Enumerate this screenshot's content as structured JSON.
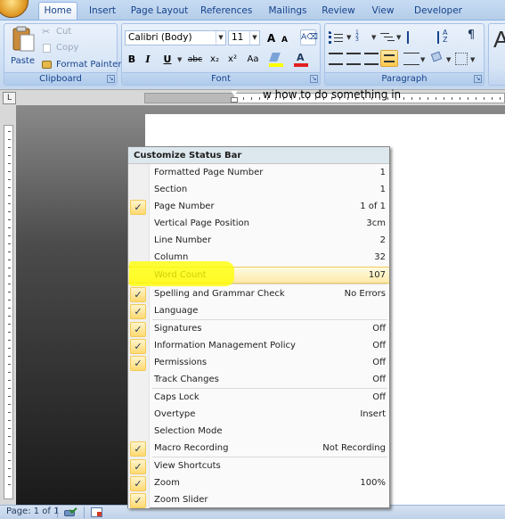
{
  "ribbon": {
    "tabs": [
      "Home",
      "Insert",
      "Page Layout",
      "References",
      "Mailings",
      "Review",
      "View",
      "Developer"
    ],
    "clipboard": {
      "paste_label": "Paste",
      "cut_label": "Cut",
      "copy_label": "Copy",
      "format_painter_label": "Format Painter",
      "group_label": "Clipboard"
    },
    "font": {
      "font_name": "Calibri (Body)",
      "font_size": "11",
      "bold": "B",
      "italic": "I",
      "underline": "U",
      "strikethrough": "abc",
      "subscript": "x₂",
      "superscript": "x²",
      "change_case": "Aa",
      "grow_font": "A",
      "shrink_font": "A",
      "font_color_glyph": "A",
      "group_label": "Font"
    },
    "paragraph": {
      "group_label": "Paragraph",
      "pilcrow": "¶"
    },
    "styles_glyph": "A"
  },
  "document": {
    "visible_text": "w how to do something in"
  },
  "status_bar": {
    "page": "Page: 1 of 1"
  },
  "menu": {
    "title": "Customize Status Bar",
    "items": [
      {
        "label": "Formatted Page Number",
        "value": "1",
        "checked": false
      },
      {
        "label": "Section",
        "value": "1",
        "checked": false
      },
      {
        "label": "Page Number",
        "value": "1 of 1",
        "checked": true
      },
      {
        "label": "Vertical Page Position",
        "value": "3cm",
        "checked": false
      },
      {
        "label": "Line Number",
        "value": "2",
        "checked": false
      },
      {
        "label": "Column",
        "value": "32",
        "checked": false
      },
      {
        "label": "Word Count",
        "value": "107",
        "checked": false,
        "highlighted": true
      },
      {
        "label": "Spelling and Grammar Check",
        "value": "No Errors",
        "checked": true
      },
      {
        "label": "Language",
        "value": "",
        "checked": true
      },
      {
        "label": "Signatures",
        "value": "Off",
        "checked": true
      },
      {
        "label": "Information Management Policy",
        "value": "Off",
        "checked": true
      },
      {
        "label": "Permissions",
        "value": "Off",
        "checked": true
      },
      {
        "label": "Track Changes",
        "value": "Off",
        "checked": false
      },
      {
        "label": "Caps Lock",
        "value": "Off",
        "checked": false
      },
      {
        "label": "Overtype",
        "value": "Insert",
        "checked": false
      },
      {
        "label": "Selection Mode",
        "value": "",
        "checked": false
      },
      {
        "label": "Macro Recording",
        "value": "Not Recording",
        "checked": true
      },
      {
        "label": "View Shortcuts",
        "value": "",
        "checked": true
      },
      {
        "label": "Zoom",
        "value": "100%",
        "checked": true
      },
      {
        "label": "Zoom Slider",
        "value": "",
        "checked": true
      }
    ],
    "check_glyph": "✓"
  },
  "colors": {
    "ribbon_blue": "#15428b",
    "menu_highlight": "#fde9a8",
    "annotation_yellow": "#ffff00"
  }
}
